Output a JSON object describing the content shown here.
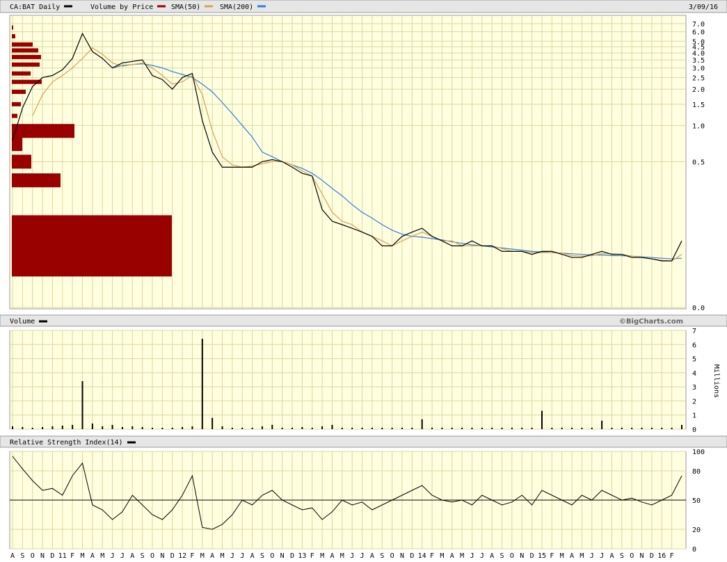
{
  "header": {
    "symbol_label": "CA:BAT Daily",
    "vbp_label": "Volume by Price",
    "sma50_label": "SMA(50)",
    "sma200_label": "SMA(200)",
    "date": "3/09/16"
  },
  "volume_panel": {
    "title": "Volume",
    "units": "Millions",
    "credit": "©BigCharts.com"
  },
  "rsi_panel": {
    "title": "Relative Strength Index(14)"
  },
  "colors": {
    "background": "#ffffe0",
    "grid": "#d8d8a0",
    "price": "#000000",
    "vbp": "#990000",
    "sma50": "#d9a050",
    "sma200": "#2f7fd8",
    "header_bar": "#e6e6e6"
  },
  "chart_data": [
    {
      "type": "line",
      "title": "CA:BAT Daily",
      "y_scale": "log",
      "y_ticks": [
        "7.0",
        "6.0",
        "5.0",
        "4.5",
        "4.0",
        "3.5",
        "3.0",
        "2.5",
        "2.0",
        "1.5",
        "1.0",
        "0.5",
        "0.0"
      ],
      "x_ticks": [
        "A",
        "S",
        "O",
        "N",
        "D",
        "11",
        "F",
        "M",
        "A",
        "M",
        "J",
        "J",
        "A",
        "S",
        "O",
        "N",
        "D",
        "12",
        "F",
        "M",
        "A",
        "M",
        "J",
        "J",
        "A",
        "S",
        "O",
        "N",
        "D",
        "13",
        "F",
        "M",
        "A",
        "M",
        "J",
        "J",
        "A",
        "S",
        "O",
        "N",
        "D",
        "14",
        "F",
        "M",
        "A",
        "M",
        "J",
        "J",
        "A",
        "S",
        "O",
        "N",
        "D",
        "15",
        "F",
        "M",
        "A",
        "M",
        "J",
        "J",
        "A",
        "S",
        "O",
        "N",
        "D",
        "16",
        "F"
      ],
      "x": [
        "2010-08",
        "2010-09",
        "2010-10",
        "2010-11",
        "2010-12",
        "2011-01",
        "2011-02",
        "2011-03",
        "2011-04",
        "2011-05",
        "2011-06",
        "2011-07",
        "2011-08",
        "2011-09",
        "2011-10",
        "2011-11",
        "2011-12",
        "2012-01",
        "2012-02",
        "2012-03",
        "2012-04",
        "2012-05",
        "2012-06",
        "2012-07",
        "2012-08",
        "2012-09",
        "2012-10",
        "2012-11",
        "2012-12",
        "2013-01",
        "2013-02",
        "2013-03",
        "2013-04",
        "2013-05",
        "2013-06",
        "2013-07",
        "2013-08",
        "2013-09",
        "2013-10",
        "2013-11",
        "2013-12",
        "2014-01",
        "2014-02",
        "2014-03",
        "2014-04",
        "2014-05",
        "2014-06",
        "2014-07",
        "2014-08",
        "2014-09",
        "2014-10",
        "2014-11",
        "2014-12",
        "2015-01",
        "2015-02",
        "2015-03",
        "2015-04",
        "2015-05",
        "2015-06",
        "2015-07",
        "2015-08",
        "2015-09",
        "2015-10",
        "2015-11",
        "2015-12",
        "2016-01",
        "2016-02",
        "2016-03"
      ],
      "series": [
        {
          "name": "CA:BAT Daily",
          "values": [
            0.75,
            1.4,
            2.1,
            2.5,
            2.6,
            2.9,
            3.6,
            5.8,
            4.1,
            3.6,
            3.0,
            3.3,
            3.4,
            3.5,
            2.6,
            2.4,
            2.0,
            2.5,
            2.7,
            1.1,
            0.6,
            0.45,
            0.45,
            0.45,
            0.45,
            0.5,
            0.52,
            0.5,
            0.45,
            0.4,
            0.38,
            0.2,
            0.16,
            0.15,
            0.14,
            0.13,
            0.12,
            0.1,
            0.1,
            0.12,
            0.13,
            0.14,
            0.12,
            0.11,
            0.1,
            0.1,
            0.11,
            0.1,
            0.1,
            0.09,
            0.09,
            0.09,
            0.085,
            0.09,
            0.09,
            0.085,
            0.08,
            0.08,
            0.085,
            0.09,
            0.085,
            0.085,
            0.08,
            0.08,
            0.078,
            0.075,
            0.075,
            0.11
          ]
        },
        {
          "name": "SMA(50)",
          "values": [
            null,
            null,
            1.2,
            1.8,
            2.3,
            2.6,
            3.0,
            3.6,
            4.4,
            3.9,
            3.3,
            3.1,
            3.2,
            3.3,
            3.0,
            2.6,
            2.2,
            2.3,
            2.6,
            1.8,
            0.9,
            0.55,
            0.47,
            0.45,
            0.46,
            0.48,
            0.5,
            0.5,
            0.47,
            0.42,
            0.38,
            0.27,
            0.19,
            0.16,
            0.15,
            0.13,
            0.12,
            0.11,
            0.1,
            0.11,
            0.12,
            0.13,
            0.12,
            0.11,
            0.11,
            0.1,
            0.1,
            0.1,
            0.1,
            0.095,
            0.09,
            0.09,
            0.088,
            0.088,
            0.088,
            0.087,
            0.083,
            0.082,
            0.083,
            0.086,
            0.086,
            0.085,
            0.082,
            0.08,
            0.078,
            0.076,
            0.075,
            0.085
          ]
        },
        {
          "name": "SMA(200)",
          "values": [
            null,
            null,
            null,
            null,
            null,
            null,
            null,
            null,
            null,
            null,
            3.0,
            3.15,
            3.2,
            3.25,
            3.15,
            3.0,
            2.8,
            2.65,
            2.5,
            2.2,
            1.9,
            1.55,
            1.25,
            1.0,
            0.8,
            0.6,
            0.55,
            0.5,
            0.47,
            0.44,
            0.4,
            0.35,
            0.3,
            0.26,
            0.22,
            0.19,
            0.17,
            0.15,
            0.135,
            0.125,
            0.12,
            0.118,
            0.115,
            0.112,
            0.108,
            0.105,
            0.102,
            0.1,
            0.098,
            0.096,
            0.094,
            0.092,
            0.09,
            0.089,
            0.088,
            0.087,
            0.086,
            0.085,
            0.084,
            0.084,
            0.083,
            0.083,
            0.082,
            0.081,
            0.08,
            0.079,
            0.078,
            0.079
          ]
        }
      ]
    },
    {
      "type": "bar",
      "title": "Volume by Price",
      "orientation": "horizontal",
      "categories": [
        "6.5",
        "5.5",
        "4.7",
        "4.2",
        "3.7",
        "3.2",
        "2.7",
        "2.3",
        "1.9",
        "1.5",
        "1.2",
        "0.9",
        "0.7",
        "0.5",
        "0.35",
        "0.1"
      ],
      "values": [
        2,
        5,
        30,
        38,
        42,
        40,
        27,
        43,
        20,
        13,
        8,
        90,
        15,
        28,
        70,
        230
      ]
    },
    {
      "type": "bar",
      "title": "Volume",
      "ylabel": "Millions",
      "y_ticks": [
        "7",
        "6",
        "5",
        "4",
        "3",
        "2",
        "1",
        "0"
      ],
      "ylim": [
        0,
        7
      ],
      "x": [
        "2010-08",
        "2010-09",
        "2010-10",
        "2010-11",
        "2010-12",
        "2011-01",
        "2011-02",
        "2011-03",
        "2011-04",
        "2011-05",
        "2011-06",
        "2011-07",
        "2011-08",
        "2011-09",
        "2011-10",
        "2011-11",
        "2011-12",
        "2012-01",
        "2012-02",
        "2012-03",
        "2012-04",
        "2012-05",
        "2012-06",
        "2012-07",
        "2012-08",
        "2012-09",
        "2012-10",
        "2012-11",
        "2012-12",
        "2013-01",
        "2013-02",
        "2013-03",
        "2013-04",
        "2013-05",
        "2013-06",
        "2013-07",
        "2013-08",
        "2013-09",
        "2013-10",
        "2013-11",
        "2013-12",
        "2014-01",
        "2014-02",
        "2014-03",
        "2014-04",
        "2014-05",
        "2014-06",
        "2014-07",
        "2014-08",
        "2014-09",
        "2014-10",
        "2014-11",
        "2014-12",
        "2015-01",
        "2015-02",
        "2015-03",
        "2015-04",
        "2015-05",
        "2015-06",
        "2015-07",
        "2015-08",
        "2015-09",
        "2015-10",
        "2015-11",
        "2015-12",
        "2016-01",
        "2016-02",
        "2016-03"
      ],
      "values": [
        0.2,
        0.15,
        0.1,
        0.15,
        0.2,
        0.25,
        0.3,
        3.4,
        0.4,
        0.2,
        0.3,
        0.15,
        0.2,
        0.15,
        0.1,
        0.1,
        0.1,
        0.15,
        0.2,
        6.4,
        0.8,
        0.2,
        0.1,
        0.1,
        0.1,
        0.2,
        0.3,
        0.1,
        0.1,
        0.15,
        0.1,
        0.2,
        0.3,
        0.1,
        0.1,
        0.1,
        0.1,
        0.1,
        0.1,
        0.1,
        0.1,
        0.7,
        0.1,
        0.1,
        0.1,
        0.1,
        0.1,
        0.1,
        0.1,
        0.1,
        0.1,
        0.1,
        0.1,
        1.3,
        0.1,
        0.1,
        0.1,
        0.1,
        0.1,
        0.6,
        0.1,
        0.1,
        0.1,
        0.1,
        0.1,
        0.1,
        0.1,
        0.3
      ]
    },
    {
      "type": "line",
      "title": "Relative Strength Index(14)",
      "y_ticks": [
        "100",
        "80",
        "50",
        "20",
        "0"
      ],
      "ylim": [
        0,
        100
      ],
      "x": [
        "2010-08",
        "2010-09",
        "2010-10",
        "2010-11",
        "2010-12",
        "2011-01",
        "2011-02",
        "2011-03",
        "2011-04",
        "2011-05",
        "2011-06",
        "2011-07",
        "2011-08",
        "2011-09",
        "2011-10",
        "2011-11",
        "2011-12",
        "2012-01",
        "2012-02",
        "2012-03",
        "2012-04",
        "2012-05",
        "2012-06",
        "2012-07",
        "2012-08",
        "2012-09",
        "2012-10",
        "2012-11",
        "2012-12",
        "2013-01",
        "2013-02",
        "2013-03",
        "2013-04",
        "2013-05",
        "2013-06",
        "2013-07",
        "2013-08",
        "2013-09",
        "2013-10",
        "2013-11",
        "2013-12",
        "2014-01",
        "2014-02",
        "2014-03",
        "2014-04",
        "2014-05",
        "2014-06",
        "2014-07",
        "2014-08",
        "2014-09",
        "2014-10",
        "2014-11",
        "2014-12",
        "2015-01",
        "2015-02",
        "2015-03",
        "2015-04",
        "2015-05",
        "2015-06",
        "2015-07",
        "2015-08",
        "2015-09",
        "2015-10",
        "2015-11",
        "2015-12",
        "2016-01",
        "2016-02",
        "2016-03"
      ],
      "values": [
        95,
        82,
        70,
        60,
        62,
        55,
        75,
        88,
        45,
        40,
        30,
        38,
        55,
        45,
        35,
        30,
        40,
        55,
        75,
        22,
        20,
        25,
        35,
        50,
        45,
        55,
        60,
        50,
        45,
        40,
        42,
        30,
        38,
        50,
        45,
        48,
        40,
        45,
        50,
        55,
        60,
        65,
        55,
        50,
        48,
        50,
        45,
        55,
        50,
        45,
        48,
        55,
        45,
        60,
        55,
        50,
        45,
        55,
        50,
        60,
        55,
        50,
        52,
        48,
        45,
        50,
        55,
        75
      ],
      "reference_line": 50
    }
  ]
}
